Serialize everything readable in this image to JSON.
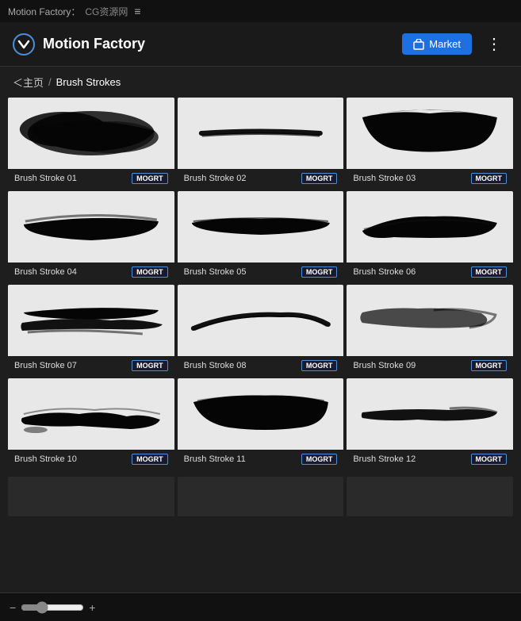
{
  "topbar": {
    "title": "Motion Factory：",
    "subtitle": "CG资源网",
    "menu_icon": "≡"
  },
  "header": {
    "logo_text": "MF",
    "title": "Motion Factory",
    "market_btn": "Market",
    "more_icon": "⋮"
  },
  "breadcrumb": {
    "home": "＜主页",
    "separator": "/",
    "current": "Brush Strokes"
  },
  "items": [
    {
      "name": "Brush Stroke 01",
      "badge": "MOGRT",
      "shape": "blob"
    },
    {
      "name": "Brush Stroke 02",
      "badge": "MOGRT",
      "shape": "thin_line"
    },
    {
      "name": "Brush Stroke 03",
      "badge": "MOGRT",
      "shape": "wide_splash"
    },
    {
      "name": "Brush Stroke 04",
      "badge": "MOGRT",
      "shape": "thick_stroke"
    },
    {
      "name": "Brush Stroke 05",
      "badge": "MOGRT",
      "shape": "long_stroke"
    },
    {
      "name": "Brush Stroke 06",
      "badge": "MOGRT",
      "shape": "angled_stroke"
    },
    {
      "name": "Brush Stroke 07",
      "badge": "MOGRT",
      "shape": "multi_stroke"
    },
    {
      "name": "Brush Stroke 08",
      "badge": "MOGRT",
      "shape": "curve_stroke"
    },
    {
      "name": "Brush Stroke 09",
      "badge": "MOGRT",
      "shape": "fade_stroke"
    },
    {
      "name": "Brush Stroke 10",
      "badge": "MOGRT",
      "shape": "scatter_stroke"
    },
    {
      "name": "Brush Stroke 11",
      "badge": "MOGRT",
      "shape": "bold_stroke"
    },
    {
      "name": "Brush Stroke 12",
      "badge": "MOGRT",
      "shape": "thin_fade"
    }
  ],
  "zoom": {
    "minus": "−",
    "plus": "+",
    "value": 30
  }
}
